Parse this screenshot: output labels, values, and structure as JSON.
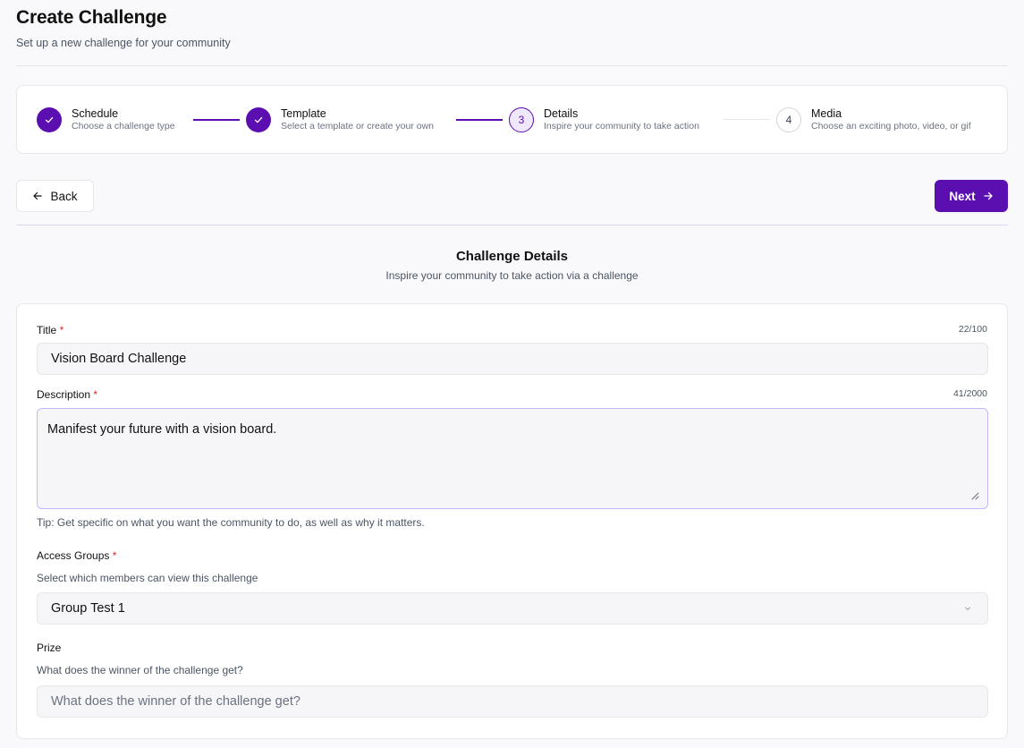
{
  "header": {
    "title": "Create Challenge",
    "subtitle": "Set up a new challenge for your community"
  },
  "stepper": {
    "steps": [
      {
        "number": "1",
        "title": "Schedule",
        "description": "Choose a challenge type",
        "state": "done"
      },
      {
        "number": "2",
        "title": "Template",
        "description": "Select a template or create your own",
        "state": "done"
      },
      {
        "number": "3",
        "title": "Details",
        "description": "Inspire your community to take action",
        "state": "current"
      },
      {
        "number": "4",
        "title": "Media",
        "description": "Choose an exciting photo, video, or gif",
        "state": "upcoming"
      }
    ]
  },
  "nav": {
    "back_label": "Back",
    "back_icon": "arrow-left-icon",
    "next_label": "Next",
    "next_icon": "arrow-right-icon"
  },
  "section": {
    "title": "Challenge Details",
    "subtitle": "Inspire your community to take action via a challenge"
  },
  "form": {
    "title": {
      "label": "Title",
      "required_mark": "*",
      "counter": "22/100",
      "value": "Vision Board Challenge"
    },
    "description": {
      "label": "Description",
      "required_mark": "*",
      "counter": "41/2000",
      "value": "Manifest your future with a vision board.",
      "tip": "Tip: Get specific on what you want the community to do, as well as why it matters."
    },
    "access_groups": {
      "label": "Access Groups",
      "required_mark": "*",
      "helper": "Select which members can view this challenge",
      "selected": "Group Test 1"
    },
    "prize": {
      "label": "Prize",
      "helper": "What does the winner of the challenge get?",
      "placeholder": "What does the winner of the challenge get?"
    }
  },
  "colors": {
    "accent": "#5b0fb0",
    "accent_light": "#efe8fb",
    "required": "#dc2626",
    "background": "#f9f9fb"
  }
}
